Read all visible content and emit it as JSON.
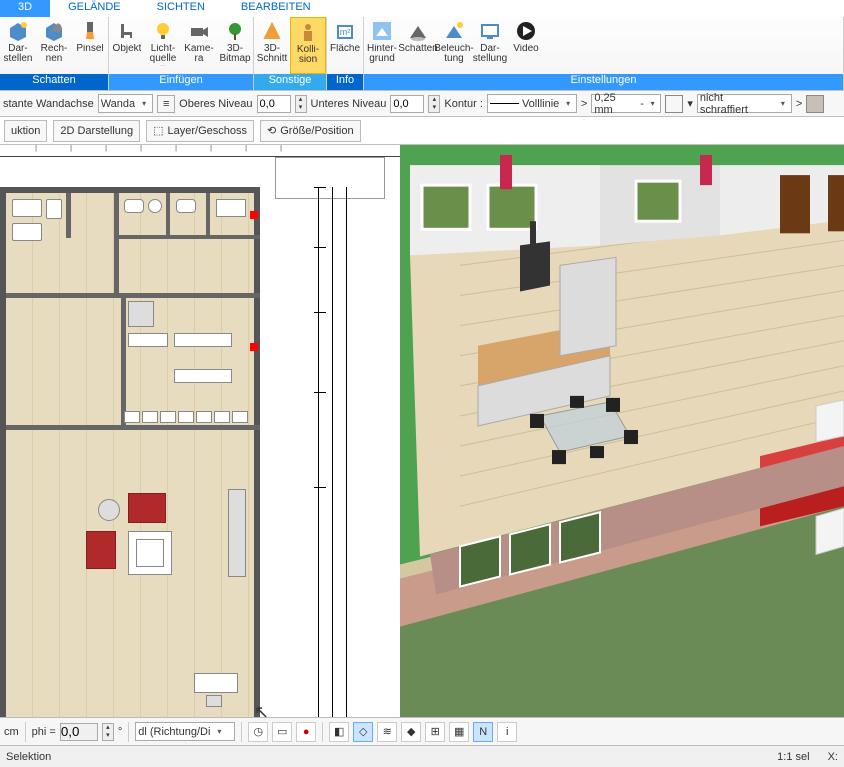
{
  "tabs": {
    "t0": "3D",
    "t1": "GELÄNDE",
    "t2": "SICHTEN",
    "t3": "BEARBEITEN"
  },
  "ribbon": {
    "group1": {
      "title": "Schatten",
      "btn1": "Dar-\nstellen",
      "btn2": "Rech-\nnen",
      "btn3": "Pinsel"
    },
    "group2": {
      "title": "Einfügen",
      "btn1": "Objekt",
      "btn2": "Licht-\nquelle ▾",
      "btn3": "Kame-\nra",
      "btn4": "3D-\nBitmap"
    },
    "group3": {
      "title": "Sonstige",
      "btn1": "3D-\nSchnitt",
      "btn2": "Kolli-\nsion"
    },
    "group4": {
      "title": "Info",
      "btn1": "Fläche"
    },
    "group5": {
      "title": "Einstellungen",
      "btn1": "Hinter-\ngrund",
      "btn2": "Schatten",
      "btn3": "Beleuch-\ntung",
      "btn4": "Dar-\nstellung",
      "btn5": "Video"
    }
  },
  "props": {
    "wandachse_label": "stante Wandachse",
    "wandachse_combo": "Wanda",
    "ober_label": "Oberes Niveau",
    "ober_val": "0,0",
    "unter_label": "Unteres Niveau",
    "unter_val": "0,0",
    "kontur_label": "Kontur :",
    "kontur_combo": "Volllinie",
    "gt": ">",
    "thickness": "0,25 mm",
    "dash": "-",
    "swatch1": "#000000",
    "hatch_label": "nicht schraffiert",
    "swatch2": "#c6c0b6"
  },
  "secondary": {
    "b1": "uktion",
    "b2": "2D Darstellung",
    "b3": "Layer/Geschoss",
    "b4": "Größe/Position"
  },
  "bottom": {
    "cm": "cm",
    "phi": "phi =",
    "phi_val": "0,0",
    "deg": "°",
    "dir": "dl (Richtung/Di",
    "snap1": "N"
  },
  "status": {
    "sel": "Selektion",
    "scale": "1:1 sel",
    "x": "X:"
  }
}
